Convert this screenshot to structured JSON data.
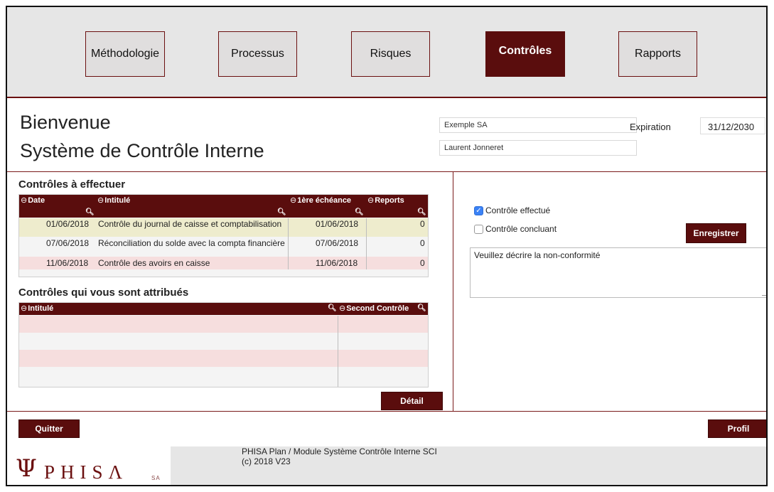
{
  "nav": {
    "items": [
      {
        "label": "Méthodologie"
      },
      {
        "label": "Processus"
      },
      {
        "label": "Risques"
      },
      {
        "label": "Contrôles"
      },
      {
        "label": "Rapports"
      }
    ],
    "active": "Contrôles"
  },
  "header": {
    "welcome_line1": "Bienvenue",
    "welcome_line2": "Système de Contrôle Interne",
    "company": "Exemple SA",
    "user": "Laurent Jonneret",
    "expiration_label": "Expiration",
    "expiration_value": "31/12/2030"
  },
  "controls_todo": {
    "title": "Contrôles à effectuer",
    "columns": [
      "Date",
      "Intitulé",
      "1ère échéance",
      "Reports"
    ],
    "rows": [
      {
        "date": "01/06/2018",
        "title": "Contrôle du journal de caisse et comptabilisation",
        "due": "01/06/2018",
        "reports": "0"
      },
      {
        "date": "07/06/2018",
        "title": "Réconciliation du solde avec la compta financière",
        "due": "07/06/2018",
        "reports": "0"
      },
      {
        "date": "11/06/2018",
        "title": "Contrôle des avoirs en caisse",
        "due": "11/06/2018",
        "reports": "0"
      }
    ]
  },
  "controls_assigned": {
    "title": "Contrôles qui vous sont attribués",
    "columns": [
      "Intitulé",
      "Second Contrôle"
    ],
    "detail_button": "Détail"
  },
  "form": {
    "checkbox_done": {
      "label": "Contrôle effectué",
      "checked": true
    },
    "checkbox_conclusive": {
      "label": "Contrôle concluant",
      "checked": false
    },
    "save_button": "Enregistrer",
    "nonconformity_text": "Veuillez décrire la non-conformité"
  },
  "bottom": {
    "quit_button": "Quitter",
    "profile_button": "Profil"
  },
  "footer": {
    "logo_symbol": "Ψ",
    "logo_text": "PHISΛ",
    "logo_suffix": "SA",
    "line1": "PHISA Plan / Module Système Contrôle Interne SCI",
    "line2": "(c) 2018 V23"
  },
  "colors": {
    "accent": "#5a0d0d",
    "row_yellow": "#eeeccd",
    "row_pink": "#f6dede",
    "checkbox_blue": "#3b82f6"
  }
}
